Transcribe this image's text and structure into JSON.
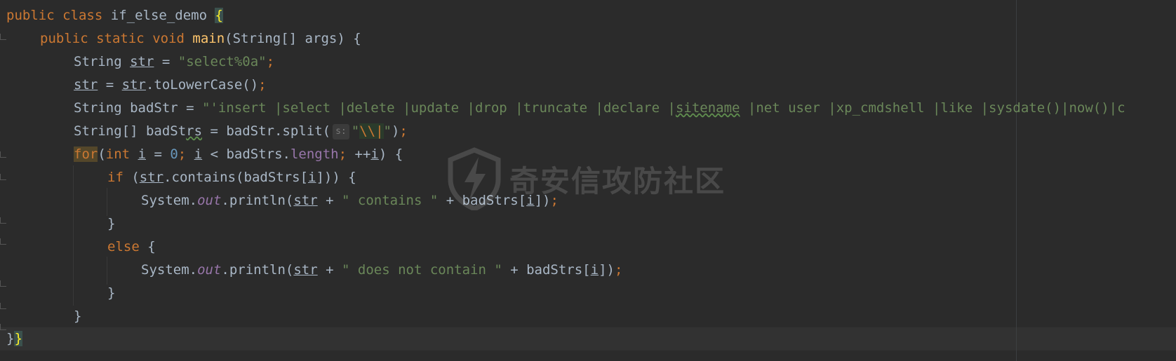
{
  "code": {
    "l1": {
      "kw1": "public",
      "kw2": "class",
      "name": "if_else_demo",
      "brace": "{"
    },
    "l2": {
      "kw1": "public",
      "kw2": "static",
      "kw3": "void",
      "fn": "main",
      "params": "(String[] args) {"
    },
    "l3": {
      "type": "String",
      "var": "str",
      "eq": " = ",
      "str": "\"select%0a\"",
      "semi": ";"
    },
    "l4": {
      "var1": "str",
      "eq": " = ",
      "var2": "str",
      "call": ".toLowerCase()",
      "semi": ";"
    },
    "l5": {
      "decl": "String badStr = ",
      "str_a": "\"'insert |select |delete |update |drop |truncate |declare |",
      "str_b": "sitename",
      "str_c": " |net user |xp_cmdshell |like |sysdate()|now()|c"
    },
    "l6": {
      "decl_a": "String[] badSt",
      "decl_b": "rs",
      "decl_c": " = badStr.split(",
      "hint": "s:",
      "q1": "\"",
      "esc": "\\\\|",
      "q2": "\"",
      "end": ")",
      "semi": ";"
    },
    "l7": {
      "kw_for": "for",
      "p_open": "(",
      "kw_int": "int",
      "v1": "i",
      "eq": " = ",
      "zero": "0",
      "semi1": "; ",
      "v2": "i",
      "lt": " < badStrs.",
      "len": "length",
      "semi2": "; ",
      "inc": "++",
      "v3": "i",
      "close": ") {"
    },
    "l8": {
      "kw_if": "if",
      "open": " (",
      "var": "str",
      "mid": ".contains(badStrs[",
      "i": "i",
      "close": "])) {"
    },
    "l9": {
      "sys": "System.",
      "out": "out",
      "print": ".println(",
      "var": "str",
      "plus1": " + ",
      "str": "\" contains \"",
      "plus2": " + badStrs[",
      "i": "i",
      "close": "])",
      "semi": ";"
    },
    "l10": {
      "brace": "}"
    },
    "l11": {
      "kw_else": "else",
      "brace": " {"
    },
    "l12": {
      "sys": "System.",
      "out": "out",
      "print": ".println(",
      "var": "str",
      "plus1": " + ",
      "str": "\" does not contain \"",
      "plus2": " + badStrs[",
      "i": "i",
      "close": "])",
      "semi": ";"
    },
    "l13": {
      "brace": "}"
    },
    "l14": {
      "brace": "}"
    },
    "l15": {
      "brace_a": "}",
      "brace_b": "}"
    }
  },
  "watermark": {
    "text": "奇安信攻防社区"
  },
  "colors": {
    "background": "#2b2b2b",
    "keyword": "#cc7832",
    "string": "#6a8759",
    "number": "#6897bb",
    "function": "#ffc66d",
    "field": "#9876aa",
    "text": "#a9b7c6"
  }
}
